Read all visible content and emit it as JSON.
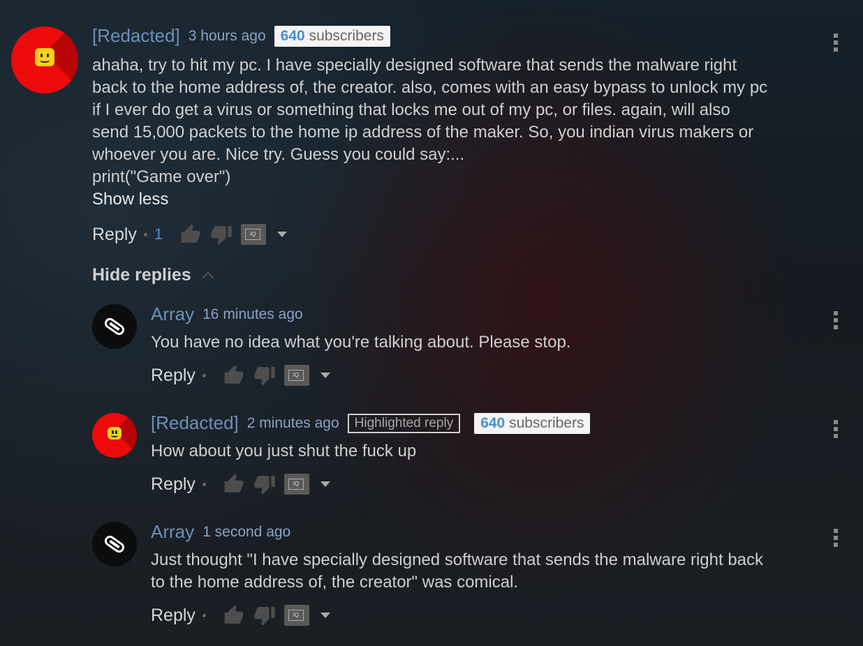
{
  "top_comment": {
    "author": "[Redacted]",
    "time": "3 hours ago",
    "badge_count": "640",
    "badge_label": "subscribers",
    "text": "ahaha, try to hit my pc. I have specially designed software that sends the malware right\nback to the home address of, the creator. also, comes with an easy bypass to unlock my pc\nif I ever do get a virus or something that locks me out of my pc, or files. again, will also\nsend 15,000 packets to the home ip address of the maker. So, you indian virus makers or\nwhoever you are. Nice try. Guess you could say:...\nprint(\"Game over\")",
    "show_less": "Show less",
    "reply_label": "Reply",
    "like_count": "1",
    "hide_replies": "Hide replies"
  },
  "replies": [
    {
      "author": "Array",
      "time": "16 minutes ago",
      "text": "You have no idea what you're talking about. Please stop.",
      "reply_label": "Reply"
    },
    {
      "author": "[Redacted]",
      "time": "2 minutes ago",
      "highlight": "Highlighted reply",
      "badge_count": "640",
      "badge_label": "subscribers",
      "text": "How about you just shut the fuck up",
      "reply_label": "Reply"
    },
    {
      "author": "Array",
      "time": "1 second ago",
      "text": "Just thought \"I have specially designed software that sends the malware right back\nto the home address of, the creator\" was comical.",
      "reply_label": "Reply"
    }
  ],
  "colors": {
    "author": "#6e8fb7",
    "link_blue": "#4a8fd1",
    "avatar_red": "#ec0a0a",
    "face_yellow": "#f3d11c"
  },
  "icons": [
    "thumbs-up-icon",
    "thumbs-down-icon",
    "iq-icon",
    "chevron-down-icon",
    "chevron-up-icon",
    "more-vert-icon"
  ]
}
